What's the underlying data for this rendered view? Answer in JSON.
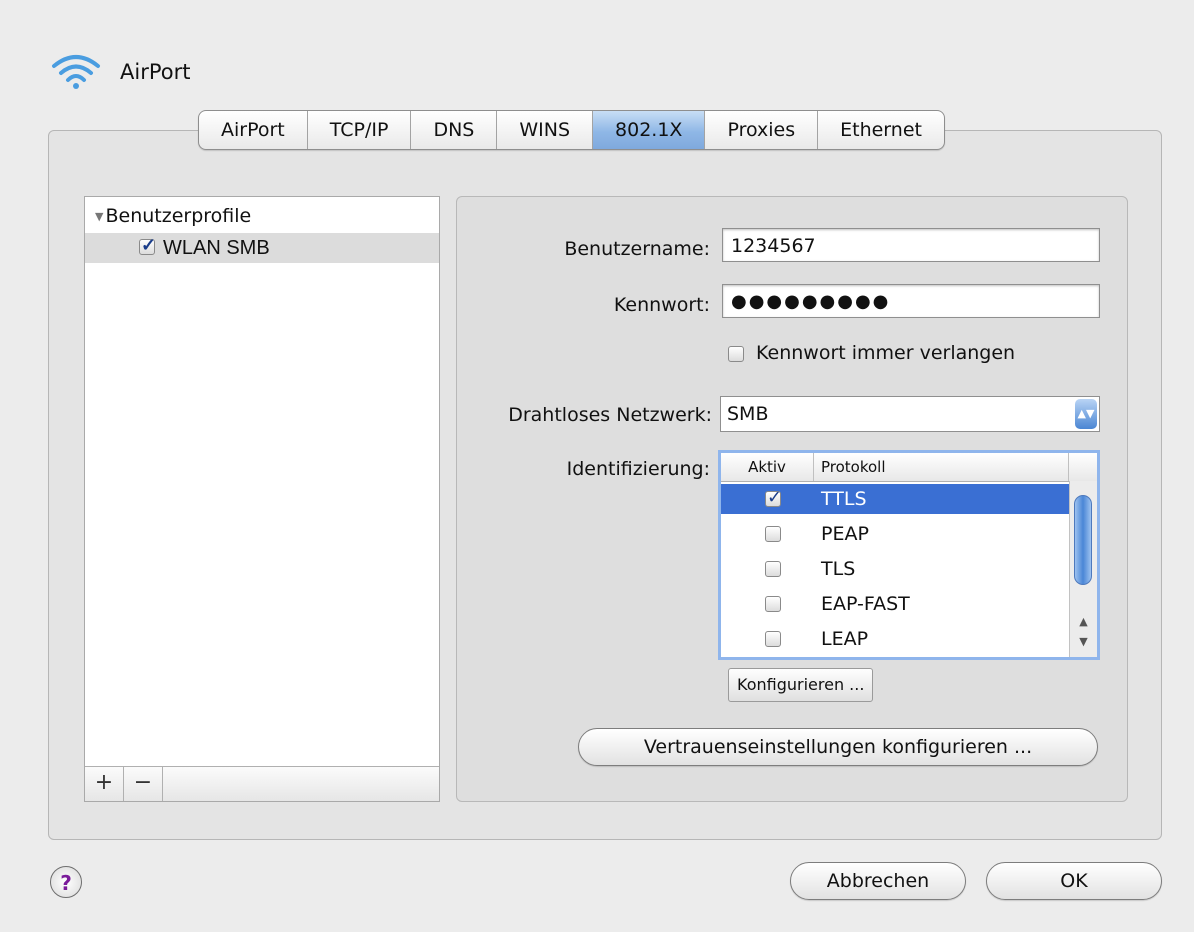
{
  "window": {
    "title": "AirPort",
    "icon": "wifi-icon"
  },
  "tabs": [
    {
      "label": "AirPort",
      "active": false
    },
    {
      "label": "TCP/IP",
      "active": false
    },
    {
      "label": "DNS",
      "active": false
    },
    {
      "label": "WINS",
      "active": false
    },
    {
      "label": "802.1X",
      "active": true
    },
    {
      "label": "Proxies",
      "active": false
    },
    {
      "label": "Ethernet",
      "active": false
    }
  ],
  "profiles": {
    "group_label": "Benutzerprofile",
    "items": [
      {
        "label": "WLAN SMB",
        "checked": true
      }
    ],
    "add_label": "+",
    "remove_label": "−"
  },
  "form": {
    "username_label": "Benutzername:",
    "username_value": "1234567",
    "password_label": "Kennwort:",
    "password_value": "●●●●●●●●●",
    "always_ask_label": "Kennwort immer verlangen",
    "network_label": "Drahtloses Netzwerk:",
    "network_value": "SMB",
    "auth_label": "Identifizierung:"
  },
  "protocols": {
    "col_active": "Aktiv",
    "col_protocol": "Protokoll",
    "rows": [
      {
        "name": "TTLS",
        "checked": true,
        "selected": true
      },
      {
        "name": "PEAP",
        "checked": false,
        "selected": false
      },
      {
        "name": "TLS",
        "checked": false,
        "selected": false
      },
      {
        "name": "EAP-FAST",
        "checked": false,
        "selected": false
      },
      {
        "name": "LEAP",
        "checked": false,
        "selected": false
      }
    ]
  },
  "buttons": {
    "configure": "Konfigurieren ...",
    "trust_settings": "Vertrauenseinstellungen konfigurieren ...",
    "cancel": "Abbrechen",
    "ok": "OK",
    "help": "?"
  },
  "colors": {
    "accent": "#3a6fd3",
    "tab_active": "#8fb7e6"
  }
}
